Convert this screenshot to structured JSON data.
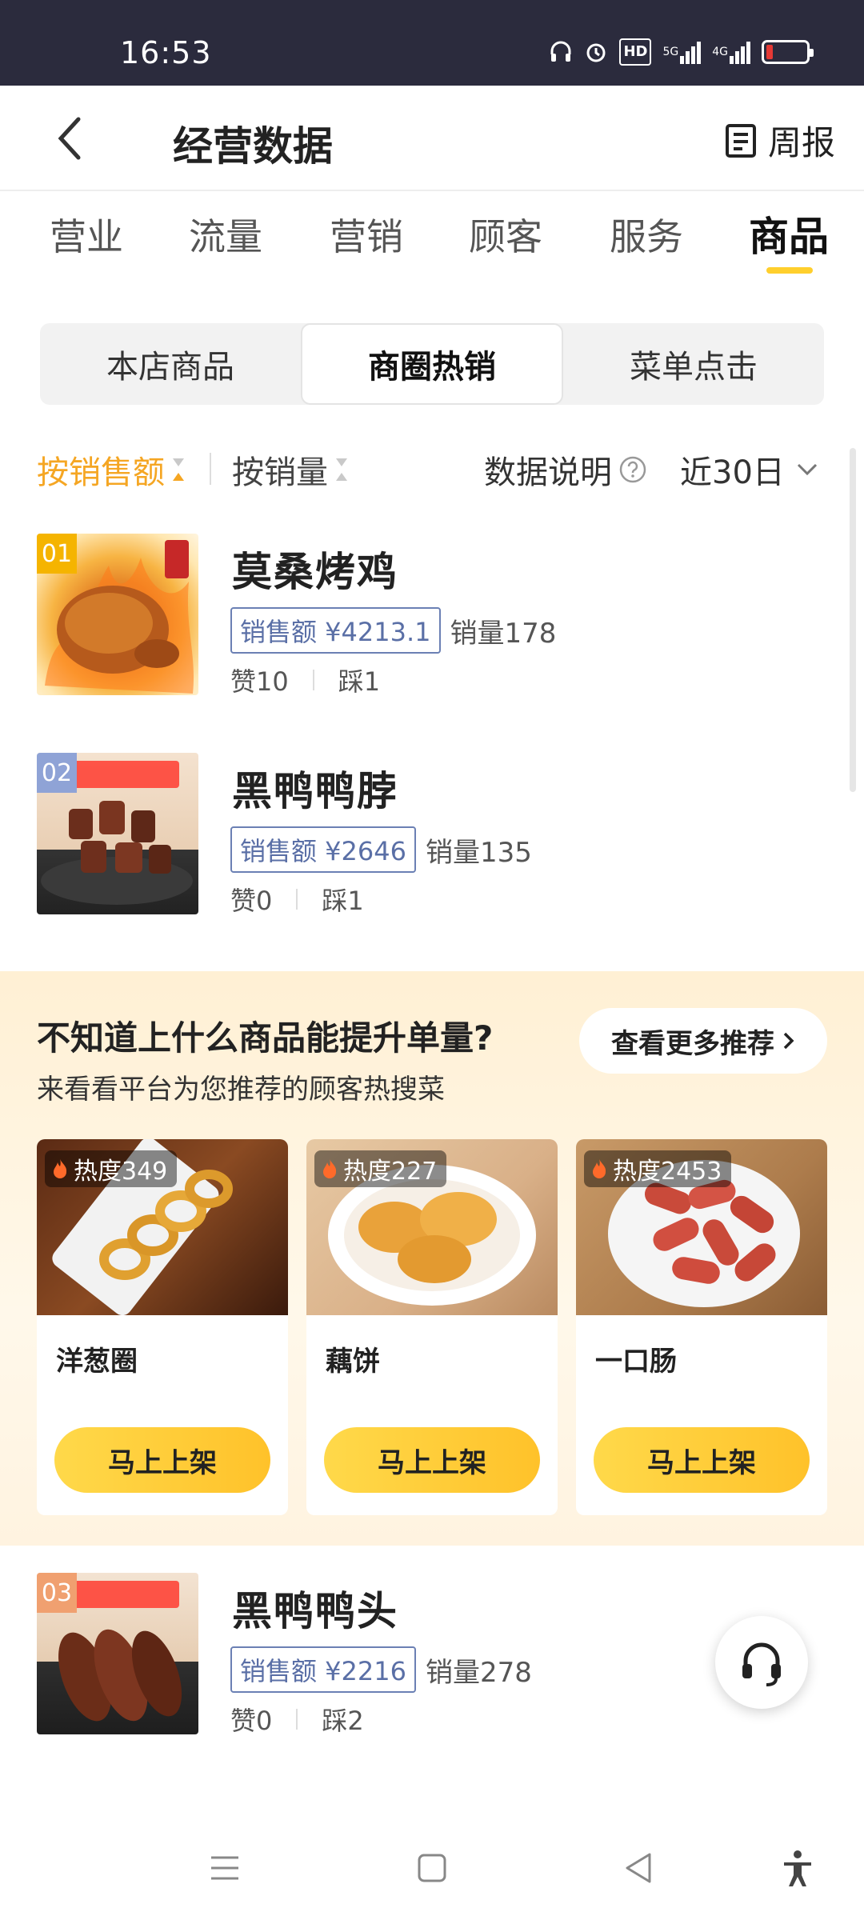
{
  "status_bar": {
    "time": "16:53",
    "icons": [
      "headphones-icon",
      "alarm-icon",
      "hd-icon",
      "5g-signal-icon",
      "4g-signal-icon",
      "battery-icon"
    ],
    "hd_label": "HD",
    "signal_5g": "5G",
    "signal_4g": "4G"
  },
  "header": {
    "title": "经营数据",
    "weekly_label": "周报"
  },
  "main_tabs": [
    "营业",
    "流量",
    "营销",
    "顾客",
    "服务",
    "商品"
  ],
  "active_main_tab": "商品",
  "segments": [
    "本店商品",
    "商圈热销",
    "菜单点击"
  ],
  "active_segment": "商圈热销",
  "sort": {
    "by_sales_amount": "按销售额",
    "by_sales_volume": "按销量",
    "data_note": "数据说明",
    "period": "近30日"
  },
  "products": [
    {
      "rank": "01",
      "name": "莫桑烤鸡",
      "sales_tag": "销售额 ¥4213.1",
      "volume": "销量178",
      "likes": "赞10",
      "dislikes": "踩1",
      "rank_color": "#f5b400"
    },
    {
      "rank": "02",
      "name": "黑鸭鸭脖",
      "sales_tag": "销售额 ¥2646",
      "volume": "销量135",
      "likes": "赞0",
      "dislikes": "踩1",
      "rank_color": "#8fa3d6"
    },
    {
      "rank": "03",
      "name": "黑鸭鸭头",
      "sales_tag": "销售额 ¥2216",
      "volume": "销量278",
      "likes": "赞0",
      "dislikes": "踩2",
      "rank_color": "#f0a070"
    }
  ],
  "recommend": {
    "title": "不知道上什么商品能提升单量?",
    "subtitle": "来看看平台为您推荐的顾客热搜菜",
    "more_label": "查看更多推荐",
    "items": [
      {
        "heat": "热度349",
        "name": "洋葱圈",
        "button": "马上上架"
      },
      {
        "heat": "热度227",
        "name": "藕饼",
        "button": "马上上架"
      },
      {
        "heat": "热度2453",
        "name": "一口肠",
        "button": "马上上架"
      }
    ]
  },
  "nav_icons": [
    "menu-icon",
    "home-square-icon",
    "back-triangle-icon",
    "accessibility-icon"
  ]
}
